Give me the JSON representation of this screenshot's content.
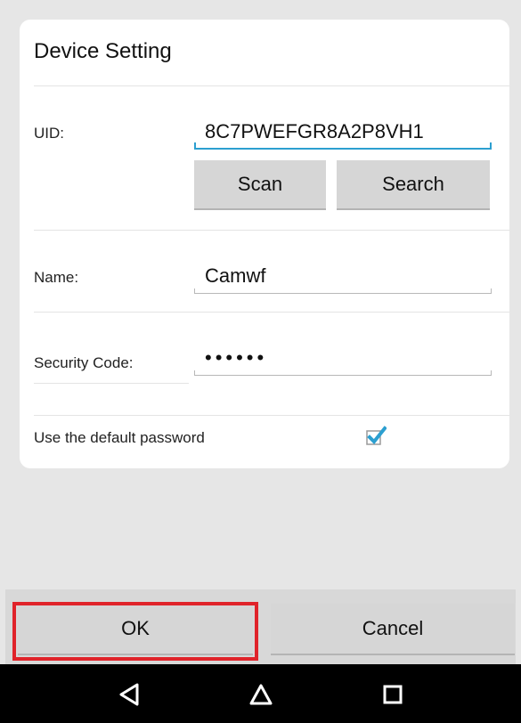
{
  "dialog": {
    "title": "Device Setting",
    "uid_label": "UID:",
    "uid_value": "8C7PWEFGR8A2P8VH1",
    "scan_label": "Scan",
    "search_label": "Search",
    "name_label": "Name:",
    "name_value": "Camwf",
    "security_label": "Security Code:",
    "security_value": "••••••",
    "default_password_label": "Use the default password",
    "default_password_checked": true
  },
  "actions": {
    "ok_label": "OK",
    "cancel_label": "Cancel"
  },
  "navbar": {
    "icons": [
      "back-icon",
      "home-icon",
      "recents-icon"
    ]
  },
  "colors": {
    "accent": "#2c9fd0",
    "highlight": "#e0232a",
    "button": "#d6d6d6",
    "navbar": "#000000"
  }
}
